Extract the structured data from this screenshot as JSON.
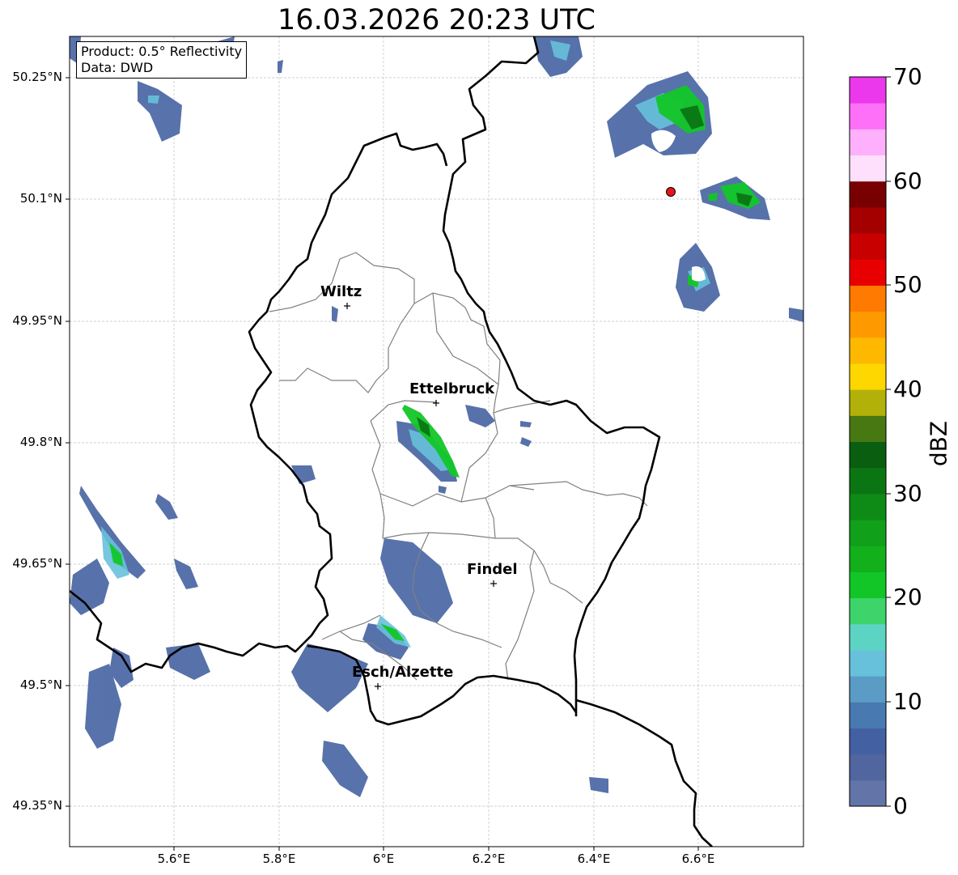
{
  "title": "16.03.2026 20:23 UTC",
  "info": {
    "product": "Product: 0.5° Reflectivity",
    "source": "Data: DWD"
  },
  "axes": {
    "lat_labels": [
      "50.25°N",
      "50.1°N",
      "49.95°N",
      "49.8°N",
      "49.65°N",
      "49.5°N",
      "49.35°N"
    ],
    "lon_labels": [
      "5.6°E",
      "5.8°E",
      "6°E",
      "6.2°E",
      "6.4°E",
      "6.6°E"
    ]
  },
  "cities": [
    {
      "name": "Wiltz"
    },
    {
      "name": "Ettelbruck"
    },
    {
      "name": "Findel"
    },
    {
      "name": "Esch/Alzette"
    }
  ],
  "colorbar": {
    "label": "dBZ",
    "ticks": [
      "0",
      "10",
      "20",
      "30",
      "40",
      "50",
      "60",
      "70"
    ],
    "colors": [
      "#6274a8",
      "#51669f",
      "#4360a3",
      "#4979b1",
      "#5a9cc5",
      "#67c1db",
      "#5dd4c3",
      "#3ed46c",
      "#12c628",
      "#12b01b",
      "#10a01a",
      "#0e8a17",
      "#0b7514",
      "#0a5e10",
      "#477812",
      "#b1b10a",
      "#fed600",
      "#feb800",
      "#fe9a00",
      "#fe7a00",
      "#e80000",
      "#c80000",
      "#a40000",
      "#780000",
      "#fee0fc",
      "#feb0fc",
      "#fe70f8",
      "#ec38ec"
    ]
  },
  "colors": {
    "border_country": "#000000",
    "border_canton": "#808080",
    "radar_marker": "#e8141c"
  }
}
